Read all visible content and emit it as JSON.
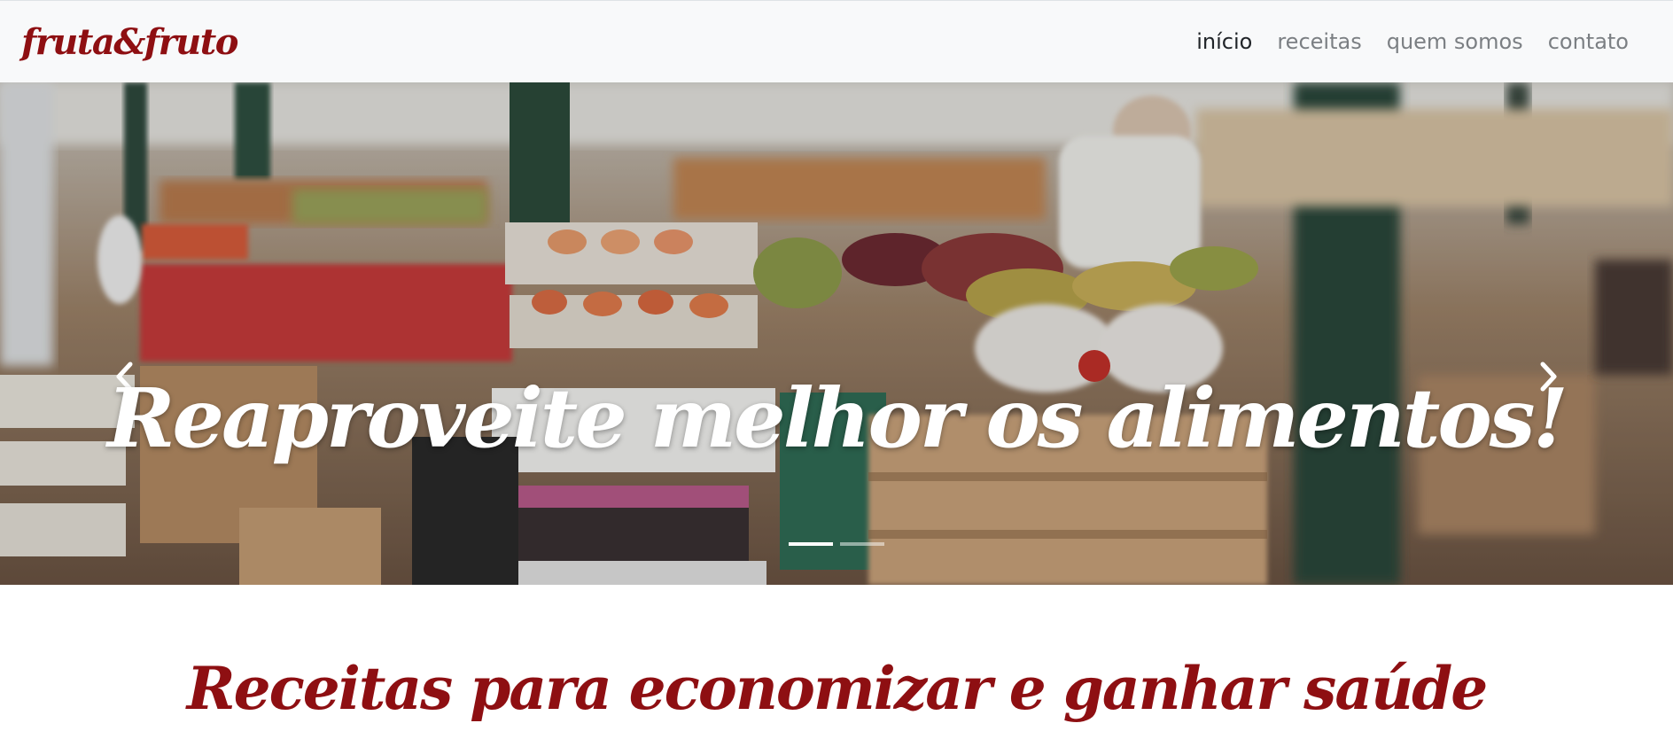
{
  "navbar": {
    "brand": "fruta&fruto",
    "links": [
      {
        "label": "início",
        "active": true
      },
      {
        "label": "receitas",
        "active": false
      },
      {
        "label": "quem somos",
        "active": false
      },
      {
        "label": "contato",
        "active": false
      }
    ]
  },
  "carousel": {
    "caption": "Reaproveite melhor os alimentos!",
    "slides_count": 2,
    "active_slide": 1,
    "prev_icon": "chevron-left-icon",
    "next_icon": "chevron-right-icon",
    "image_subject": "market-stall-photo"
  },
  "section": {
    "title": "Receitas para economizar e ganhar saúde"
  },
  "colors": {
    "brand": "#8e0f12",
    "navbar_bg": "#f8f9fa",
    "nav_active": "#212529",
    "nav_inactive": "#7b7f83"
  }
}
